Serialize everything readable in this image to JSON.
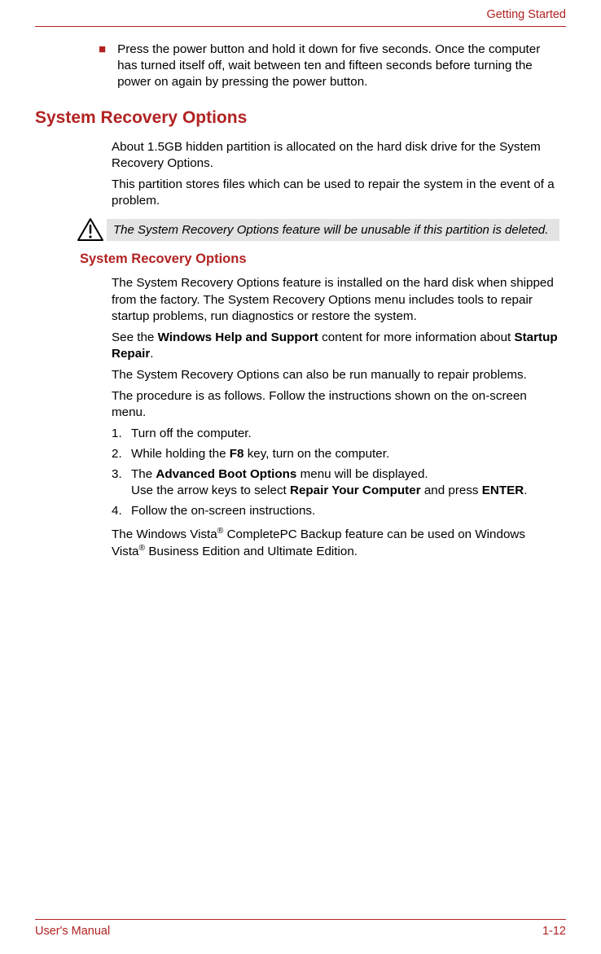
{
  "header": {
    "section": "Getting Started"
  },
  "intro_bullet": "Press the power button and hold it down for five seconds. Once the computer has turned itself off, wait between ten and fifteen seconds before turning the power on again by pressing the power button.",
  "h1": "System Recovery Options",
  "p1": "About 1.5GB hidden partition is allocated on the hard disk drive for the System Recovery Options.",
  "p2": "This partition stores files which can be used to repair the system in the event of a problem.",
  "callout": "The System Recovery Options feature will be unusable if this partition is deleted.",
  "h2": "System Recovery Options",
  "p3": "The System Recovery Options feature is installed on the hard disk when shipped from the factory. The System Recovery Options menu includes tools to repair startup problems, run diagnostics or restore the system.",
  "p4a": "See the ",
  "p4b": "Windows Help and Support",
  "p4c": " content for more information about ",
  "p4d": "Startup Repair",
  "p4e": ".",
  "p5": "The System Recovery Options can also be run manually to repair problems.",
  "p6": "The procedure is as follows. Follow the instructions shown on the on-screen menu.",
  "steps": {
    "n1": "1.",
    "t1": "Turn off the computer.",
    "n2": "2.",
    "t2a": "While holding the ",
    "t2b": "F8",
    "t2c": " key, turn on the computer.",
    "n3": "3.",
    "t3a": "The ",
    "t3b": "Advanced Boot Options",
    "t3c": " menu will be displayed.",
    "t3d": "Use the arrow keys to select ",
    "t3e": "Repair Your Computer",
    "t3f": " and press ",
    "t3g": "ENTER",
    "t3h": ".",
    "n4": "4.",
    "t4": "Follow the on-screen instructions."
  },
  "p7a": "The Windows Vista",
  "p7b": "®",
  "p7c": " CompletePC Backup feature can be used on Windows Vista",
  "p7d": "®",
  "p7e": " Business Edition and Ultimate Edition.",
  "footer": {
    "left": "User's Manual",
    "right": "1-12"
  }
}
